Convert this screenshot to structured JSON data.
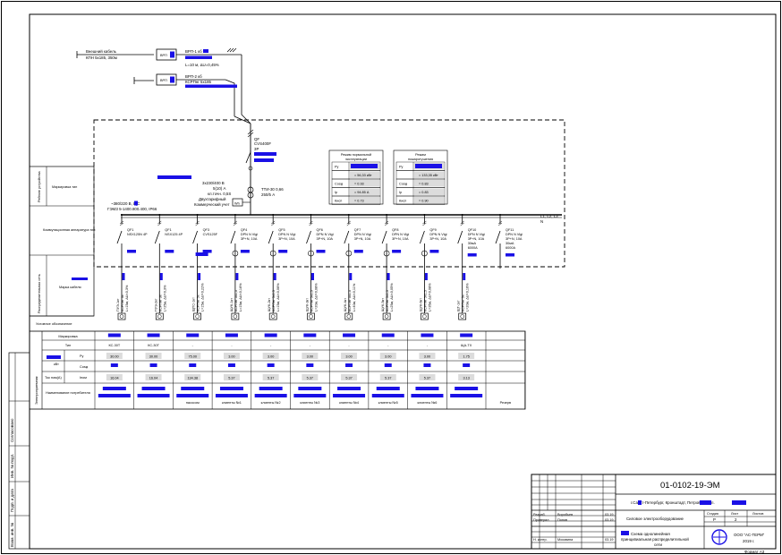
{
  "colors": {
    "ink": "#000000",
    "mark": "#1a10e6",
    "bg": "#ffffff",
    "box": "#dcdcdc"
  },
  "supply": {
    "ext_cable": "Внешний кабель",
    "ext_cable_type": "КПН 5х185, 350м",
    "line1": "ВРП-1 кб",
    "line1_len": "L=10 м, ΔU=0,45%",
    "line2": "ВРП-2 кб",
    "line2_cable": "КСРПнг 5х185"
  },
  "input": {
    "breaker": "QF",
    "breaker_type": "CVS400F",
    "breaker_poles": "3P",
    "ct_type": "ТТИ-30 0,66",
    "ct_ratio": "250/5 А",
    "meter_label": "Двухтарифный",
    "meter_label2": "Коммерческий учет",
    "meter_spec1": "3х230/400 В",
    "meter_spec2": "5(10) А",
    "meter_spec3": "кл.точн. 0,5S",
    "enclosure_label": "~380/220 В, ЩС",
    "enclosure_spec": "ГЭМЗ 5-1400.800.400, IP66",
    "ua_label": "Wh",
    "bus_label": "L1, L2, L3",
    "bus_label2": "N"
  },
  "mode_normal": {
    "title": "Режим нормальной",
    "title2": "эксплуатации",
    "rows": [
      {
        "k": "Ру",
        "v": ""
      },
      {
        "k": "",
        "v": "= 56,33 кВт"
      },
      {
        "k": "Cosφ",
        "v": "= 0.93"
      },
      {
        "k": "Ip",
        "v": "= 94.85 А"
      },
      {
        "k": "Кисп",
        "v": "= 0.73"
      }
    ]
  },
  "mode_fire": {
    "title": "Режим",
    "title2": "пожаротушения",
    "rows": [
      {
        "k": "Ру",
        "v": ""
      },
      {
        "k": "",
        "v": "= 133,35 кВт"
      },
      {
        "k": "Cosφ",
        "v": "= 0.83"
      },
      {
        "k": "Ip",
        "v": "= 0.83"
      },
      {
        "k": "Кисп",
        "v": "= 0.90"
      }
    ]
  },
  "left_labels": {
    "device_rating": "Рейтинг устройства",
    "marking_type": "Маркировка тип",
    "switching_device": "Коммутационная аппаратура тип",
    "distribution_network": "Распределительная сеть",
    "cable_mark": "Марка кабеля",
    "symbol": "Условное обозначение",
    "consumer": "Электроприемник"
  },
  "feeders": [
    {
      "id": "QF1",
      "type": "NSX125N 4P",
      "rating": "",
      "cable": "ПУЭ-1кт",
      "cable2": "КСРПнг 3х",
      "len": "L=15м, ΔU=0,3%"
    },
    {
      "id": "QF1",
      "type": "NSX125 4P",
      "rating": "",
      "cable": "ПУЭ-2кт",
      "cable2": "КСРПнг 3х",
      "len": "L=25м, ΔU=0,3%"
    },
    {
      "id": "QF3",
      "type": "CVS125F",
      "rating": "",
      "cable": "ЩПС-1кт",
      "cable2": "КСРПнг 5х",
      "len": "L=15м, ΔU=0,22%"
    },
    {
      "id": "QF4",
      "type": "DPN N Vigi",
      "rating": "3P+N, 10А",
      "cable": "ЩУК-1кт",
      "cable2": "КСРПнг 5х1,5",
      "len": "L=15м, ΔU=0,16%"
    },
    {
      "id": "QF5",
      "type": "DPN N Vigi",
      "rating": "3P+N, 10А",
      "cable": "ЩУК-2кт",
      "cable2": "КСРПнг 5х1,5",
      "len": "L=15м, ΔU=0,06%"
    },
    {
      "id": "QF6",
      "type": "DPN N Vigi",
      "rating": "3P+N, 10А",
      "cable": "ЩУК-3кт",
      "cable2": "КСРПнг 5х1,5",
      "len": "L=20м, ΔU=0,08%"
    },
    {
      "id": "QF7",
      "type": "DPN N Vigi",
      "rating": "3P+N, 10А",
      "cable": "ЩУК-4кт",
      "cable2": "КСРПнг 5х1,5",
      "len": "L=40м, ΔU=0,11%"
    },
    {
      "id": "QF8",
      "type": "DPN N Vigi",
      "rating": "3P+N, 10А",
      "cable": "ЩУК-5кт",
      "cable2": "КСРПнг 5х1,5",
      "len": "L=25м, ΔU=0,05%"
    },
    {
      "id": "QF9",
      "type": "DPN N Vigi",
      "rating": "3P+N, 10А",
      "cable": "ЩУК-6кт",
      "cable2": "КСРПнг 5х1,5",
      "len": "L=35м, ΔU=0,08%"
    },
    {
      "id": "QF10",
      "type": "DPN N Vigi",
      "rating": "3P+N, 10А",
      "rating2": "30мА",
      "rating3": "6000А",
      "cable": "ЩТ-1кт",
      "cable2": "КСРПнг 5х",
      "len": "L=20м, ΔU=0,16%"
    },
    {
      "id": "QF11",
      "type": "DPN N Vigi",
      "rating": "3P+N, 10А",
      "rating2": "30мА",
      "rating3": "6000А",
      "cable": "",
      "cable2": "",
      "len": ""
    }
  ],
  "table": {
    "row_labels": [
      "Маркировка",
      "Тип",
      "Ру",
      "Cosφ",
      "Ток ном(А)",
      "Iном",
      "Наименование потребителя"
    ],
    "sub_label_kvt": "кВт",
    "types": [
      "КС-30Т",
      "КС-30Т",
      "-",
      "-",
      "-",
      "-",
      "-",
      "-",
      "-",
      "ЩА-ТХ",
      ""
    ],
    "py": [
      "30.00",
      "30.00",
      "75.00",
      "3.00",
      "3.00",
      "3.00",
      "3.00",
      "3.00",
      "3.00",
      "1.75",
      ""
    ],
    "inom": [
      "16.04",
      "16.04",
      "134.38",
      "5.37",
      "5.37",
      "5.37",
      "5.37",
      "5.37",
      "5.37",
      "3.13",
      ""
    ],
    "consumers": [
      "",
      "",
      "насосом",
      "клиенты №1",
      "клиенты №2",
      "клиенты №3",
      "клиенты №4",
      "клиенты №5",
      "клиенты №6",
      "",
      "Резерв"
    ]
  },
  "stamp": {
    "code": "01-0102-19-ЭМ",
    "address": "г.Санкт-Петербург, Кронштадт, Петровская ул.",
    "section": "Силовое электрооборудование",
    "stage_h": "Стадия",
    "sheet_h": "Лист",
    "sheets_h": "Листов",
    "stage": "Р",
    "sheet": "2",
    "sheets": "",
    "drawing_title": "Схема однолинейная принципиальная распределительной сети",
    "company": "ООО \"АС-ТЕРМ\"",
    "year": "2019 г.",
    "format": "Формат А3",
    "roles": [
      {
        "role": "Разраб.",
        "name": "Воробьев",
        "date": "03.19"
      },
      {
        "role": "Проверил",
        "name": "Попов",
        "date": "03.19"
      },
      {
        "role": "",
        "name": "",
        "date": ""
      },
      {
        "role": "Н. контр.",
        "name": "Москвина",
        "date": "03.19"
      }
    ]
  },
  "side_stamp": [
    "Взам. инв. №",
    "Подп. и дата",
    "Инв. № подл.",
    "Согласовано"
  ]
}
